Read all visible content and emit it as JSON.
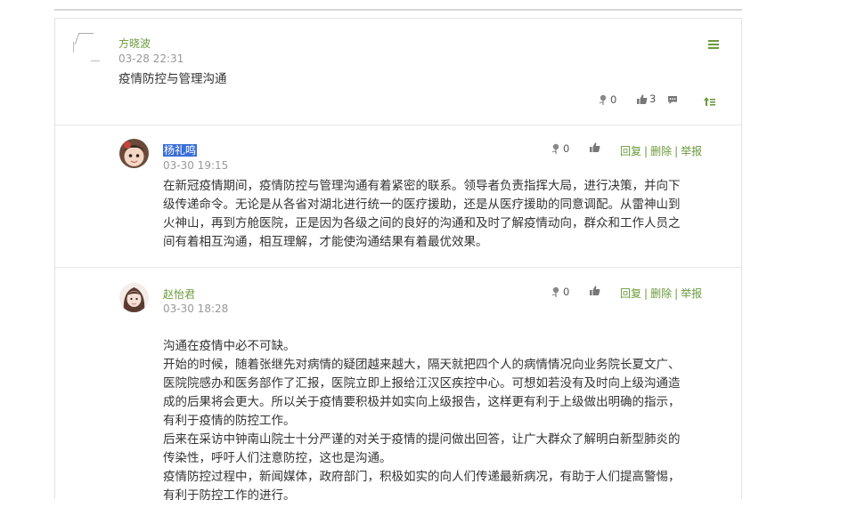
{
  "post": {
    "author": "方晓波",
    "time": "03-28 22:31",
    "title": "疫情防控与管理沟通",
    "flower_count": "0",
    "like_count": "3"
  },
  "replies": [
    {
      "author": "杨礼鸣",
      "time": "03-30 19:15",
      "flower_count": "0",
      "lines": [
        "在新冠疫情期间，疫情防控与管理沟通有着紧密的联系。领导者负责指挥大局，进行决策，并向下",
        "级传递命令。无论是从各省对湖北进行统一的医疗援助，还是从医疗援助的同意调配。从雷神山到",
        "火神山，再到方舱医院，正是因为各级之间的良好的沟通和及时了解疫情动向，群众和工作人员之",
        "间有着相互沟通，相互理解，才能使沟通结果有着最优效果。"
      ]
    },
    {
      "author": "赵怡君",
      "time": "03-30 18:28",
      "flower_count": "0",
      "lines": [
        "沟通在疫情中必不可缺。",
        "开始的时候，随着张继先对病情的疑团越来越大，隔天就把四个人的病情情况向业务院长夏文广、",
        "医院院感办和医务部作了汇报，医院立即上报给江汉区疾控中心。可想如若没有及时向上级沟通造",
        "成的后果将会更大。所以关于疫情要积极并如实向上级报告，这样更有利于上级做出明确的指示，",
        "有利于疫情的防控工作。",
        "后来在采访中钟南山院士十分严谨的对关于疫情的提问做出回答，让广大群众了解明白新型肺炎的",
        "传染性，呼吁人们注意防控，这也是沟通。",
        "疫情防控过程中，新闻媒体，政府部门，积极如实的向人们传递最新病况，有助于人们提高警惕，",
        "有利于防控工作的进行。"
      ]
    }
  ],
  "actions": {
    "reply": "回复",
    "delete": "删除",
    "report": "举报",
    "sep": "|"
  },
  "colors": {
    "accent": "#6a9b3c",
    "selection": "#3a6fd8"
  }
}
